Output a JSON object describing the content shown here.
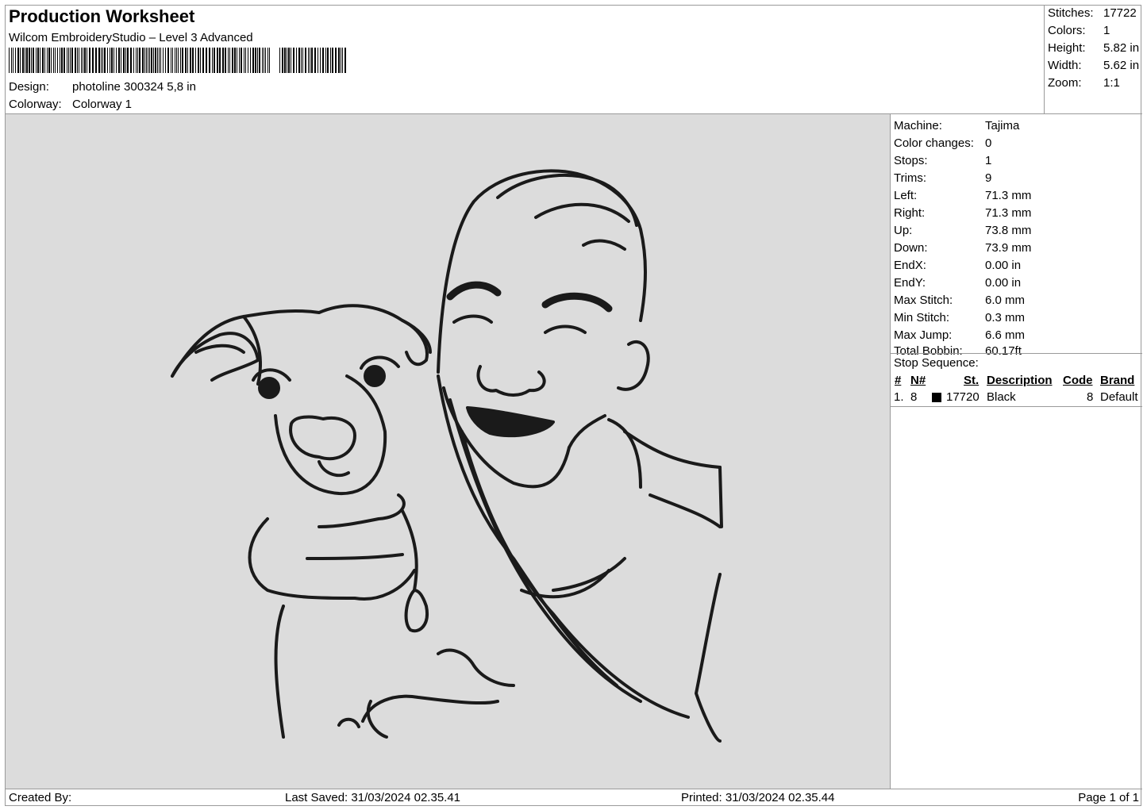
{
  "header": {
    "title": "Production Worksheet",
    "software": "Wilcom EmbroideryStudio – Level 3 Advanced",
    "design_label": "Design:",
    "design_value": "photoline 300324 5,8 in",
    "colorway_label": "Colorway:",
    "colorway_value": "Colorway 1"
  },
  "summary": [
    {
      "label": "Stitches:",
      "value": "17722"
    },
    {
      "label": "Colors:",
      "value": "1"
    },
    {
      "label": "Height:",
      "value": "5.82 in"
    },
    {
      "label": "Width:",
      "value": "5.62 in"
    },
    {
      "label": "Zoom:",
      "value": "1:1"
    }
  ],
  "properties": [
    {
      "label": "Machine:",
      "value": "Tajima"
    },
    {
      "label": "Color changes:",
      "value": "0"
    },
    {
      "label": "Stops:",
      "value": "1"
    },
    {
      "label": "Trims:",
      "value": "9"
    },
    {
      "label": "Left:",
      "value": "71.3 mm"
    },
    {
      "label": "Right:",
      "value": "71.3 mm"
    },
    {
      "label": "Up:",
      "value": "73.8 mm"
    },
    {
      "label": "Down:",
      "value": "73.9 mm"
    },
    {
      "label": "EndX:",
      "value": "0.00 in"
    },
    {
      "label": "EndY:",
      "value": "0.00 in"
    },
    {
      "label": "Max Stitch:",
      "value": "6.0 mm"
    },
    {
      "label": "Min Stitch:",
      "value": "0.3 mm"
    },
    {
      "label": "Max Jump:",
      "value": "6.6 mm"
    },
    {
      "label": "Total Bobbin:",
      "value": "60.17ft"
    }
  ],
  "stop_sequence": {
    "title": "Stop Sequence:",
    "headers": [
      "#",
      "N#",
      "St.",
      "Description",
      "Code",
      "Brand"
    ],
    "rows": [
      {
        "index": "1.",
        "needle": "8",
        "color": "#000000",
        "stitches": "17720",
        "description": "Black",
        "code": "8",
        "brand": "Default"
      }
    ]
  },
  "footer": {
    "created_by": "Created By:",
    "last_saved": "Last Saved: 31/03/2024 02.35.41",
    "printed": "Printed: 31/03/2024 02.35.44",
    "page": "Page 1 of 1"
  },
  "colors": {
    "canvas_bg": "#dcdcdc",
    "thread": "#1a1a1a"
  }
}
